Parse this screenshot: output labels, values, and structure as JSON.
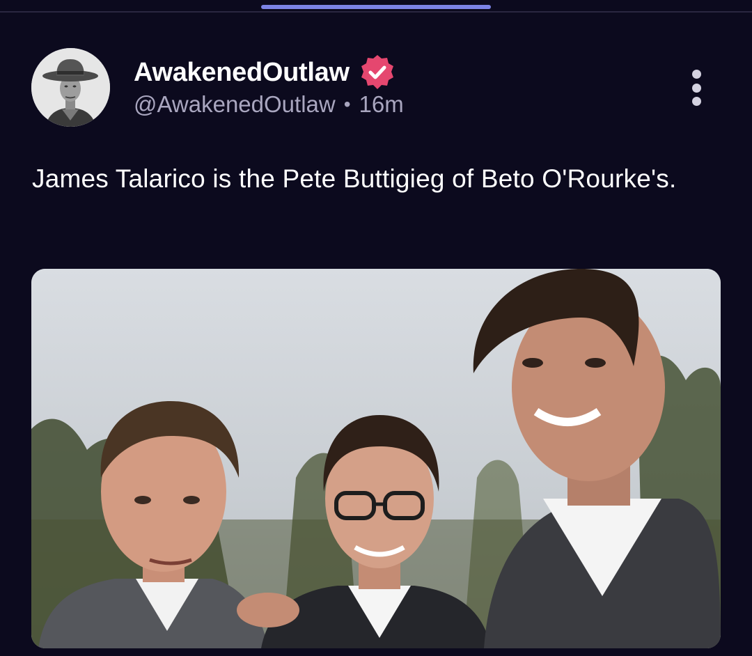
{
  "post": {
    "author": {
      "display_name": "AwakenedOutlaw",
      "handle": "@AwakenedOutlaw",
      "verified": true,
      "avatar_icon": "cowboy-portrait-avatar"
    },
    "separator": "•",
    "timestamp": "16m",
    "text": "James Talarico is the Pete Buttigieg of Beto O'Rourke's.",
    "media": {
      "kind": "photo",
      "subject_count": 3
    }
  },
  "icons": {
    "verified": "verified-badge-icon",
    "more": "more-options-icon"
  },
  "colors": {
    "background": "#0c0a1e",
    "text_primary": "#ffffff",
    "text_secondary": "#a9a6bf",
    "verified_badge": "#e5476f",
    "progress_accent": "#7c83e6"
  }
}
